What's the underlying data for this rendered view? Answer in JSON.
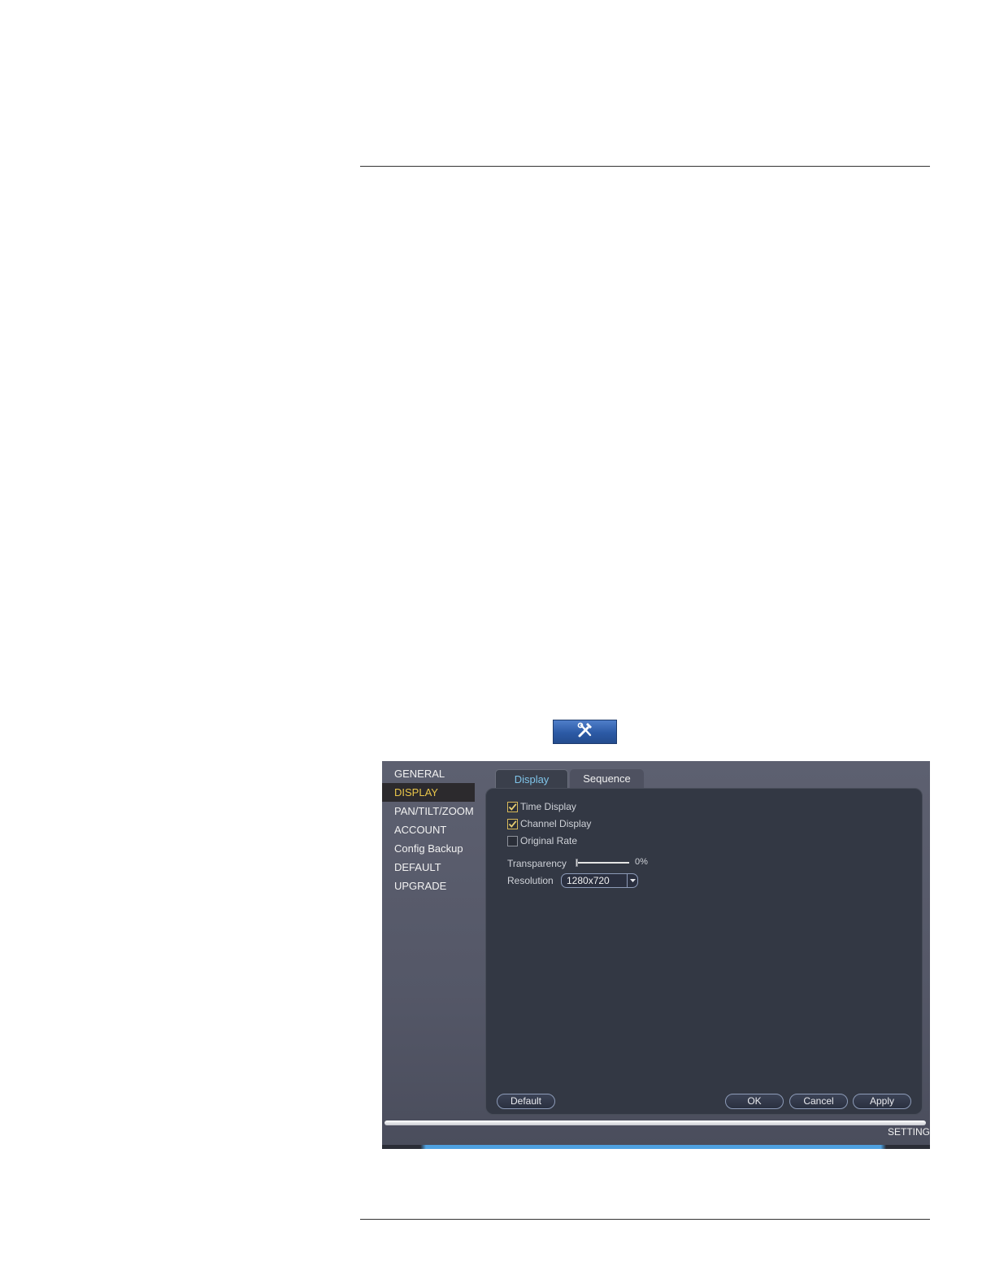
{
  "sidebar": {
    "items": [
      {
        "label": "GENERAL",
        "active": false
      },
      {
        "label": "DISPLAY",
        "active": true
      },
      {
        "label": "PAN/TILT/ZOOM",
        "active": false
      },
      {
        "label": "ACCOUNT",
        "active": false
      },
      {
        "label": "Config Backup",
        "active": false
      },
      {
        "label": "DEFAULT",
        "active": false
      },
      {
        "label": "UPGRADE",
        "active": false
      }
    ]
  },
  "tabs": [
    {
      "label": "Display",
      "active": true
    },
    {
      "label": "Sequence",
      "active": false
    }
  ],
  "display": {
    "time_display": {
      "label": "Time Display",
      "checked": true
    },
    "channel_display": {
      "label": "Channel Display",
      "checked": true
    },
    "original_rate": {
      "label": "Original Rate",
      "checked": false
    },
    "transparency": {
      "label": "Transparency",
      "value_text": "0%",
      "value": 0
    },
    "resolution": {
      "label": "Resolution",
      "value": "1280x720"
    }
  },
  "buttons": {
    "default": "Default",
    "ok": "OK",
    "cancel": "Cancel",
    "apply": "Apply"
  },
  "status": {
    "label": "SETTING"
  },
  "toolbar": {
    "icon": "tools-icon"
  },
  "colors": {
    "active_menu": "#e9c54a",
    "active_tab": "#7fc4e9",
    "checkbox_border": "#d8b95a"
  }
}
